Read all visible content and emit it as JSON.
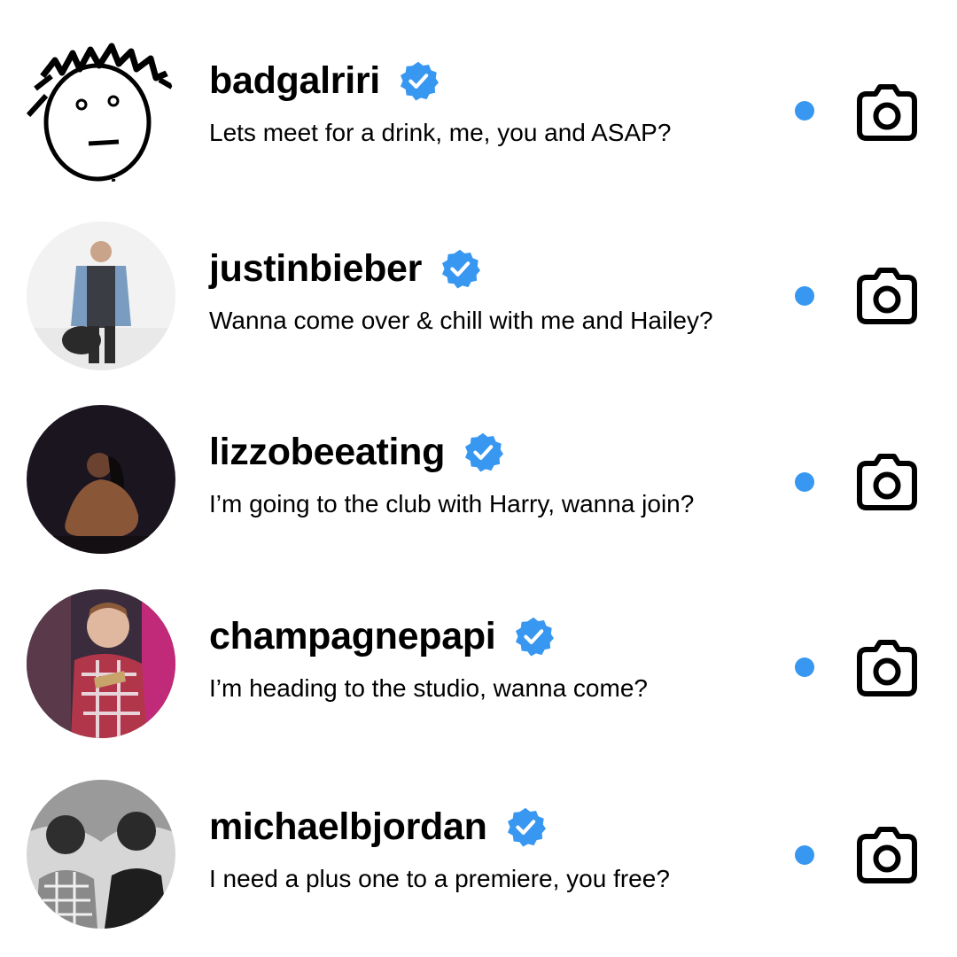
{
  "accent_color": "#3897f0",
  "conversations": [
    {
      "username": "badgalriri",
      "verified": true,
      "message": "Lets meet for a drink, me, you and ASAP?",
      "unread": true,
      "avatar_icon": "doodle-face-icon"
    },
    {
      "username": "justinbieber",
      "verified": true,
      "message": "Wanna come over & chill with me and Hailey?",
      "unread": true,
      "avatar_icon": "person-photo"
    },
    {
      "username": "lizzobeeating",
      "verified": true,
      "message": "I’m going to the club with Harry, wanna join?",
      "unread": true,
      "avatar_icon": "person-photo"
    },
    {
      "username": "champagnepapi",
      "verified": true,
      "message": "I’m heading to the studio, wanna come?",
      "unread": true,
      "avatar_icon": "person-photo"
    },
    {
      "username": "michaelbjordan",
      "verified": true,
      "message": "I need a plus one to a premiere, you free?",
      "unread": true,
      "avatar_icon": "person-photo"
    }
  ]
}
